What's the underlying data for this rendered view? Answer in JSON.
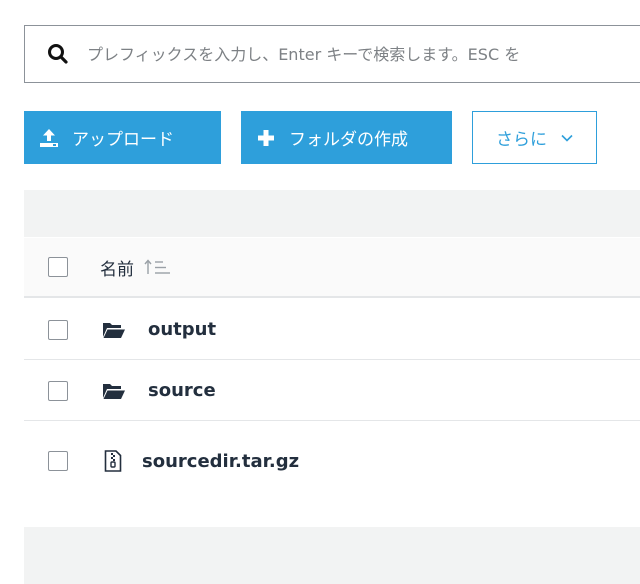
{
  "search": {
    "placeholder": "プレフィックスを入力し、Enter キーで検索します。ESC を"
  },
  "toolbar": {
    "upload_label": "アップロード",
    "create_folder_label": "フォルダの作成",
    "more_label": "さらに"
  },
  "table": {
    "header": {
      "name_label": "名前"
    },
    "rows": [
      {
        "name": "output",
        "type": "folder",
        "icon": "folder-open-icon"
      },
      {
        "name": "source",
        "type": "folder",
        "icon": "folder-open-icon"
      },
      {
        "name": "sourcedir.tar.gz",
        "type": "file",
        "icon": "zip-file-icon"
      }
    ]
  },
  "colors": {
    "accent": "#2e9fdb",
    "text": "#232f3e",
    "band": "#f2f3f3",
    "border": "#e4e6e8"
  }
}
